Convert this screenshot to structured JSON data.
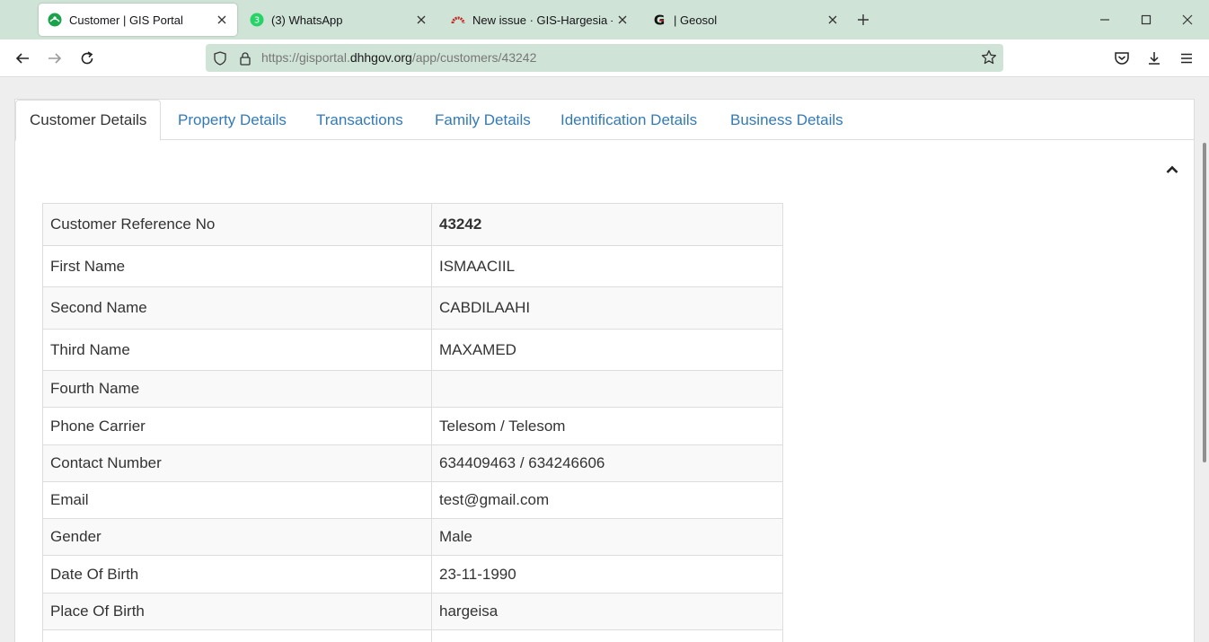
{
  "browser": {
    "tabs": [
      {
        "title": "Customer | GIS Portal",
        "icon": "gis-portal-icon",
        "active": true
      },
      {
        "title": "(3) WhatsApp",
        "icon": "whatsapp-icon",
        "badge": "3"
      },
      {
        "title": "New issue · GIS-Hargesia - Team",
        "icon": "gitlab-icon"
      },
      {
        "title": "| Geosol",
        "icon": "geosol-icon",
        "letter": "G"
      }
    ],
    "url": {
      "prefix": "https://gisportal.",
      "host": "dhhgov.org",
      "path": "/app/customers/43242"
    }
  },
  "page": {
    "tabs": [
      {
        "label": "Customer Details"
      },
      {
        "label": "Property Details"
      },
      {
        "label": "Transactions"
      },
      {
        "label": "Family Details"
      },
      {
        "label": "Identification Details"
      },
      {
        "label": "Business Details"
      }
    ],
    "rows": [
      {
        "label": "Customer Reference No",
        "value": "43242"
      },
      {
        "label": "First Name",
        "value": "ISMAACIIL"
      },
      {
        "label": "Second Name",
        "value": "CABDILAAHI"
      },
      {
        "label": "Third Name",
        "value": "MAXAMED"
      },
      {
        "label": "Fourth Name",
        "value": ""
      },
      {
        "label": "Phone Carrier",
        "value": "Telesom / Telesom"
      },
      {
        "label": "Contact Number",
        "value": "634409463 / 634246606"
      },
      {
        "label": "Email",
        "value": "test@gmail.com"
      },
      {
        "label": "Gender",
        "value": "Male"
      },
      {
        "label": "Date Of Birth",
        "value": "23-11-1990"
      },
      {
        "label": "Place Of Birth",
        "value": "hargeisa"
      },
      {
        "label": "",
        "value": ""
      }
    ]
  }
}
